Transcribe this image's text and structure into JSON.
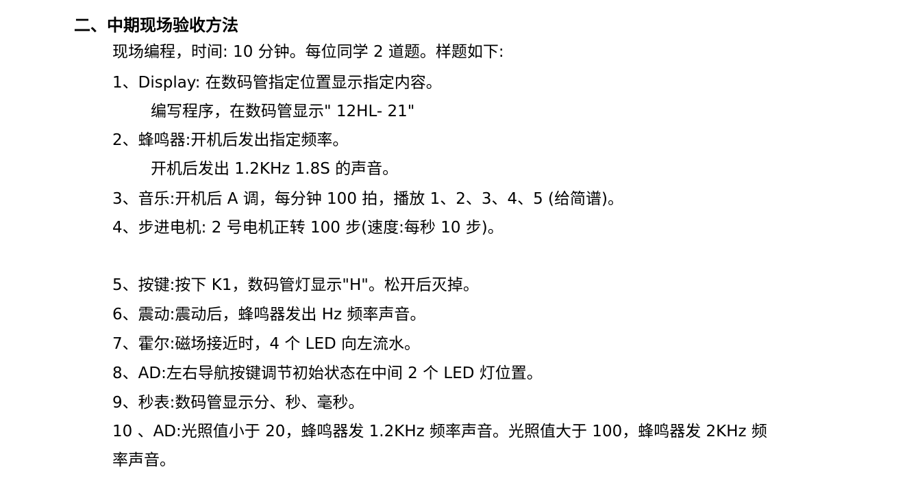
{
  "document": {
    "heading": "二、中期现场验收方法",
    "intro": "现场编程，时间: 10 分钟。每位同学 2 道题。样题如下:",
    "items": [
      "1、Display: 在数码管指定位置显示指定内容。",
      "编写程序，在数码管显示\"  12HL- 21\"",
      "2、蜂鸣器:开机后发出指定频率。",
      "开机后发出 1.2KHz 1.8S 的声音。",
      "3、音乐:开机后 A 调，每分钟 100 拍，播放 1、2、3、4、5 (给简谱)。",
      "4、步进电机: 2 号电机正转 100 步(速度:每秒 10 步)。",
      "5、按键:按下 K1，数码管灯显示\"H\"。松开后灭掉。",
      "6、震动:震动后，蜂鸣器发出 Hz 频率声音。",
      "7、霍尔:磁场接近时，4 个 LED 向左流水。",
      "8、AD:左右导航按键调节初始状态在中间 2 个 LED 灯位置。",
      "9、秒表:数码管显示分、秒、毫秒。",
      "10 、AD:光照值小于 20，蜂鸣器发 1.2KHz 频率声音。光照值大于 100，蜂鸣器发 2KHz 频",
      "率声音。"
    ]
  }
}
